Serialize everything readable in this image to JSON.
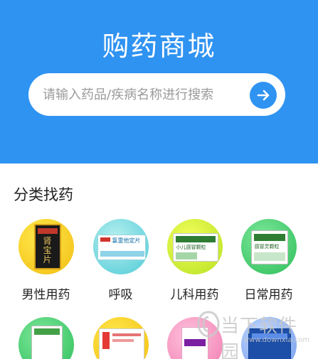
{
  "hero": {
    "title": "购药商城"
  },
  "search": {
    "placeholder": "请输入药品/疾病名称进行搜索"
  },
  "categories_section": {
    "title": "分类找药"
  },
  "categories": [
    {
      "label": "男性用药",
      "package_text": "肾宝片",
      "color": "#f2bd12"
    },
    {
      "label": "呼吸",
      "package_text": "氯雷他定片",
      "color": "#4fcbd6"
    },
    {
      "label": "儿科用药",
      "package_text": "小儿感冒颗粒",
      "color": "#b6e021"
    },
    {
      "label": "日常用药",
      "package_text": "感冒灵颗粒",
      "color": "#2dbd5a"
    }
  ],
  "watermark": {
    "text": "当下软件园",
    "url": "www.downxia.com"
  },
  "colors": {
    "accent": "#2f93f2",
    "background": "#ffffff"
  }
}
